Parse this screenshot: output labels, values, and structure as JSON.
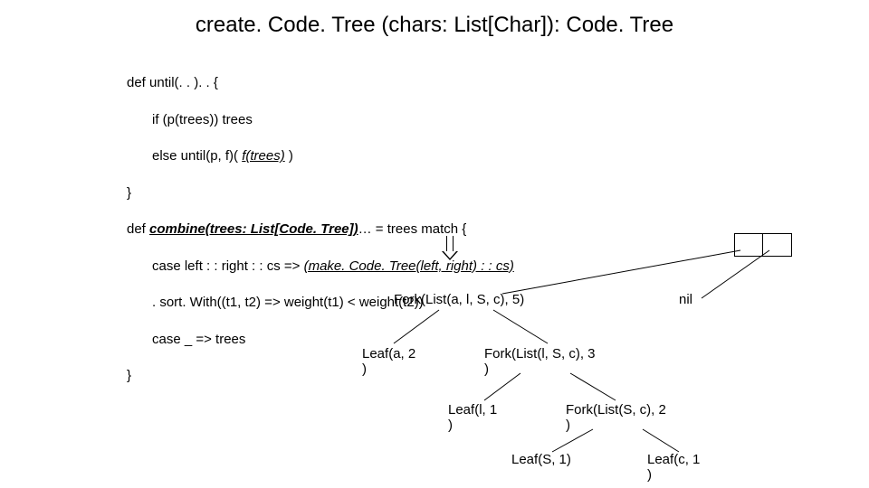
{
  "title": "create. Code. Tree (chars: List[Char]): Code. Tree",
  "code": {
    "l1": "def until(. . ). . {",
    "l2": "if (p(trees)) trees",
    "l3a": "else until(p, f)( ",
    "l3b": "f(trees)",
    "l3c": " )",
    "l4": "}",
    "l5a": "def ",
    "l5b": "combine(trees: List[Code. Tree])",
    "l5c": "… = trees match {",
    "l6a": "case left : : right : : cs => ",
    "l6b": "(make. Code. Tree(left, right) : : cs)",
    "l7": ". sort. With((t1, t2) => weight(t1) < weight(t2))",
    "l8": "case _ => trees",
    "l9": "}"
  },
  "tree": {
    "nil": "nil",
    "n1": "Fork(List(a, l, S, c), 5)",
    "n2a": "Leaf(a, 2\n)",
    "n2b": "Fork(List(l, S, c), 3\n)",
    "n3a": "Leaf(l, 1\n)",
    "n3b": "Fork(List(S, c), 2\n)",
    "n4a": "Leaf(S, 1)",
    "n4b": "Leaf(c, 1\n)"
  }
}
